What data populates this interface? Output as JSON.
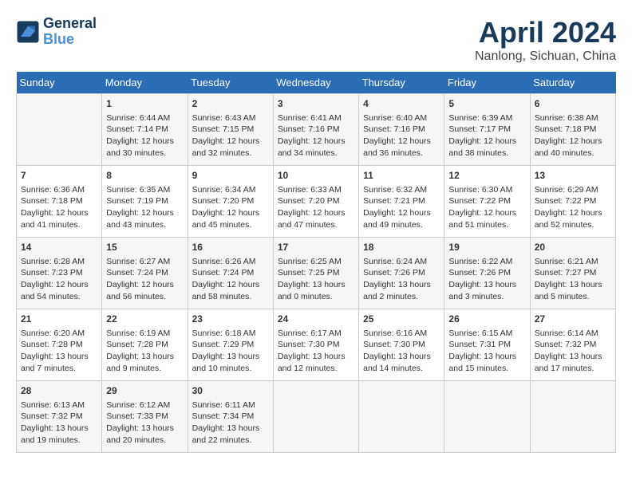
{
  "header": {
    "logo_line1": "General",
    "logo_line2": "Blue",
    "month": "April 2024",
    "location": "Nanlong, Sichuan, China"
  },
  "weekdays": [
    "Sunday",
    "Monday",
    "Tuesday",
    "Wednesday",
    "Thursday",
    "Friday",
    "Saturday"
  ],
  "weeks": [
    [
      {
        "day": "",
        "sunrise": "",
        "sunset": "",
        "daylight": ""
      },
      {
        "day": "1",
        "sunrise": "Sunrise: 6:44 AM",
        "sunset": "Sunset: 7:14 PM",
        "daylight": "Daylight: 12 hours and 30 minutes."
      },
      {
        "day": "2",
        "sunrise": "Sunrise: 6:43 AM",
        "sunset": "Sunset: 7:15 PM",
        "daylight": "Daylight: 12 hours and 32 minutes."
      },
      {
        "day": "3",
        "sunrise": "Sunrise: 6:41 AM",
        "sunset": "Sunset: 7:16 PM",
        "daylight": "Daylight: 12 hours and 34 minutes."
      },
      {
        "day": "4",
        "sunrise": "Sunrise: 6:40 AM",
        "sunset": "Sunset: 7:16 PM",
        "daylight": "Daylight: 12 hours and 36 minutes."
      },
      {
        "day": "5",
        "sunrise": "Sunrise: 6:39 AM",
        "sunset": "Sunset: 7:17 PM",
        "daylight": "Daylight: 12 hours and 38 minutes."
      },
      {
        "day": "6",
        "sunrise": "Sunrise: 6:38 AM",
        "sunset": "Sunset: 7:18 PM",
        "daylight": "Daylight: 12 hours and 40 minutes."
      }
    ],
    [
      {
        "day": "7",
        "sunrise": "Sunrise: 6:36 AM",
        "sunset": "Sunset: 7:18 PM",
        "daylight": "Daylight: 12 hours and 41 minutes."
      },
      {
        "day": "8",
        "sunrise": "Sunrise: 6:35 AM",
        "sunset": "Sunset: 7:19 PM",
        "daylight": "Daylight: 12 hours and 43 minutes."
      },
      {
        "day": "9",
        "sunrise": "Sunrise: 6:34 AM",
        "sunset": "Sunset: 7:20 PM",
        "daylight": "Daylight: 12 hours and 45 minutes."
      },
      {
        "day": "10",
        "sunrise": "Sunrise: 6:33 AM",
        "sunset": "Sunset: 7:20 PM",
        "daylight": "Daylight: 12 hours and 47 minutes."
      },
      {
        "day": "11",
        "sunrise": "Sunrise: 6:32 AM",
        "sunset": "Sunset: 7:21 PM",
        "daylight": "Daylight: 12 hours and 49 minutes."
      },
      {
        "day": "12",
        "sunrise": "Sunrise: 6:30 AM",
        "sunset": "Sunset: 7:22 PM",
        "daylight": "Daylight: 12 hours and 51 minutes."
      },
      {
        "day": "13",
        "sunrise": "Sunrise: 6:29 AM",
        "sunset": "Sunset: 7:22 PM",
        "daylight": "Daylight: 12 hours and 52 minutes."
      }
    ],
    [
      {
        "day": "14",
        "sunrise": "Sunrise: 6:28 AM",
        "sunset": "Sunset: 7:23 PM",
        "daylight": "Daylight: 12 hours and 54 minutes."
      },
      {
        "day": "15",
        "sunrise": "Sunrise: 6:27 AM",
        "sunset": "Sunset: 7:24 PM",
        "daylight": "Daylight: 12 hours and 56 minutes."
      },
      {
        "day": "16",
        "sunrise": "Sunrise: 6:26 AM",
        "sunset": "Sunset: 7:24 PM",
        "daylight": "Daylight: 12 hours and 58 minutes."
      },
      {
        "day": "17",
        "sunrise": "Sunrise: 6:25 AM",
        "sunset": "Sunset: 7:25 PM",
        "daylight": "Daylight: 13 hours and 0 minutes."
      },
      {
        "day": "18",
        "sunrise": "Sunrise: 6:24 AM",
        "sunset": "Sunset: 7:26 PM",
        "daylight": "Daylight: 13 hours and 2 minutes."
      },
      {
        "day": "19",
        "sunrise": "Sunrise: 6:22 AM",
        "sunset": "Sunset: 7:26 PM",
        "daylight": "Daylight: 13 hours and 3 minutes."
      },
      {
        "day": "20",
        "sunrise": "Sunrise: 6:21 AM",
        "sunset": "Sunset: 7:27 PM",
        "daylight": "Daylight: 13 hours and 5 minutes."
      }
    ],
    [
      {
        "day": "21",
        "sunrise": "Sunrise: 6:20 AM",
        "sunset": "Sunset: 7:28 PM",
        "daylight": "Daylight: 13 hours and 7 minutes."
      },
      {
        "day": "22",
        "sunrise": "Sunrise: 6:19 AM",
        "sunset": "Sunset: 7:28 PM",
        "daylight": "Daylight: 13 hours and 9 minutes."
      },
      {
        "day": "23",
        "sunrise": "Sunrise: 6:18 AM",
        "sunset": "Sunset: 7:29 PM",
        "daylight": "Daylight: 13 hours and 10 minutes."
      },
      {
        "day": "24",
        "sunrise": "Sunrise: 6:17 AM",
        "sunset": "Sunset: 7:30 PM",
        "daylight": "Daylight: 13 hours and 12 minutes."
      },
      {
        "day": "25",
        "sunrise": "Sunrise: 6:16 AM",
        "sunset": "Sunset: 7:30 PM",
        "daylight": "Daylight: 13 hours and 14 minutes."
      },
      {
        "day": "26",
        "sunrise": "Sunrise: 6:15 AM",
        "sunset": "Sunset: 7:31 PM",
        "daylight": "Daylight: 13 hours and 15 minutes."
      },
      {
        "day": "27",
        "sunrise": "Sunrise: 6:14 AM",
        "sunset": "Sunset: 7:32 PM",
        "daylight": "Daylight: 13 hours and 17 minutes."
      }
    ],
    [
      {
        "day": "28",
        "sunrise": "Sunrise: 6:13 AM",
        "sunset": "Sunset: 7:32 PM",
        "daylight": "Daylight: 13 hours and 19 minutes."
      },
      {
        "day": "29",
        "sunrise": "Sunrise: 6:12 AM",
        "sunset": "Sunset: 7:33 PM",
        "daylight": "Daylight: 13 hours and 20 minutes."
      },
      {
        "day": "30",
        "sunrise": "Sunrise: 6:11 AM",
        "sunset": "Sunset: 7:34 PM",
        "daylight": "Daylight: 13 hours and 22 minutes."
      },
      {
        "day": "",
        "sunrise": "",
        "sunset": "",
        "daylight": ""
      },
      {
        "day": "",
        "sunrise": "",
        "sunset": "",
        "daylight": ""
      },
      {
        "day": "",
        "sunrise": "",
        "sunset": "",
        "daylight": ""
      },
      {
        "day": "",
        "sunrise": "",
        "sunset": "",
        "daylight": ""
      }
    ]
  ]
}
